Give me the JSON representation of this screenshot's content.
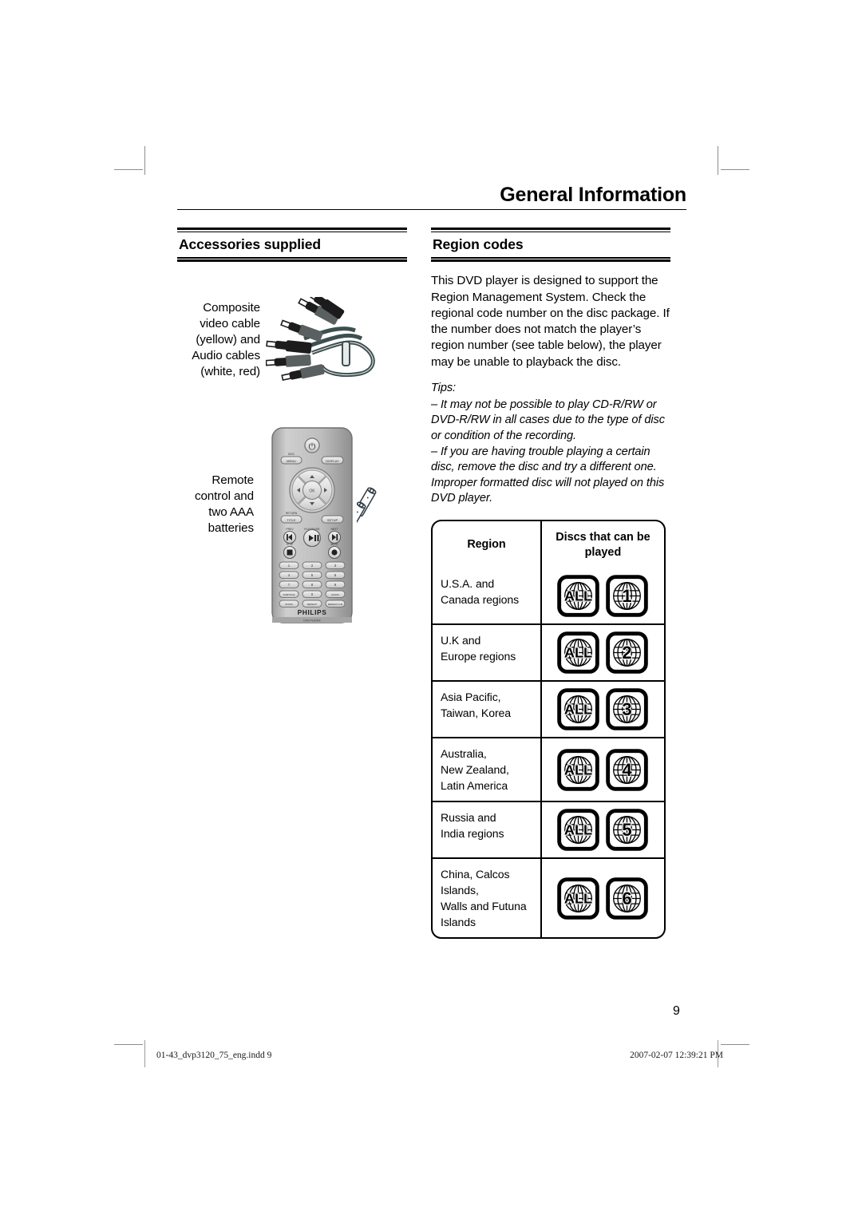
{
  "running_head": "General Information",
  "page_number": "9",
  "sections": {
    "accessories": {
      "title": "Accessories supplied",
      "items": [
        {
          "label_lines": [
            "Composite",
            "video cable",
            "(yellow) and",
            "Audio cables",
            "(white, red)"
          ],
          "art": "composite-av-cable"
        },
        {
          "label_lines": [
            "Remote",
            "control and",
            "two AAA",
            "batteries"
          ],
          "art": "remote-control-and-batteries"
        }
      ]
    },
    "region_codes": {
      "title": "Region codes",
      "body": "This DVD player is designed to support the Region Management System. Check the regional code number on the disc package. If the number does not match the player’s region number (see table below), the player may be unable to playback the disc.",
      "tips_label": "Tips:",
      "tips": [
        "– It may not be possible to play CD-R/RW or DVD-R/RW in all cases due to the type of disc or condition of the recording.",
        "– If you are having trouble playing a certain disc, remove the disc and try a different one. Improper formatted disc will not played on this DVD player."
      ],
      "table": {
        "headers": [
          "Region",
          "Discs that can be played"
        ],
        "rows": [
          {
            "region": "U.S.A. and\nCanada regions",
            "badges": [
              "ALL",
              "1"
            ]
          },
          {
            "region": "U.K and\nEurope regions",
            "badges": [
              "ALL",
              "2"
            ]
          },
          {
            "region": "Asia Pacific,\nTaiwan, Korea",
            "badges": [
              "ALL",
              "3"
            ]
          },
          {
            "region": "Australia,\nNew Zealand,\nLatin America",
            "badges": [
              "ALL",
              "4"
            ]
          },
          {
            "region": "Russia and\nIndia regions",
            "badges": [
              "ALL",
              "5"
            ]
          },
          {
            "region": "China, Calcos Islands,\nWalls and Futuna\nIslands",
            "badges": [
              "ALL",
              "6"
            ]
          }
        ]
      }
    }
  },
  "remote": {
    "brand": "PHILIPS",
    "model_text": "DVD PLAYER",
    "buttons": {
      "disc_menu": "DISC MENU",
      "display": "DISPLAY",
      "ok": "OK",
      "return_title": "RETURN/TITLE",
      "setup": "SETUP",
      "prev": "PREV",
      "next": "NEXT",
      "play_pause": "PLAY/PAUSE",
      "stop": "STOP",
      "mute": "MUTE",
      "keypad": [
        "1",
        "2",
        "3",
        "4",
        "5",
        "6",
        "7",
        "8",
        "9"
      ],
      "subtitle": "SUBTITLE",
      "zero": "0",
      "audio": "AUDIO",
      "zoom": "ZOOM",
      "repeat": "REPEAT",
      "repeat_ab": "REPEAT A-B"
    }
  },
  "footer": {
    "file": "01-43_dvp3120_75_eng.indd   9",
    "timestamp": "2007-02-07   12:39:21 PM"
  },
  "colors": {
    "ink": "#000000",
    "cable_body": "#3d4f50",
    "cable_plug_dark": "#1c1c1c",
    "cable_plug_grey": "#5a5f60",
    "remote_body": "#b9b9b9",
    "crop_mark": "#8d8d8d"
  }
}
